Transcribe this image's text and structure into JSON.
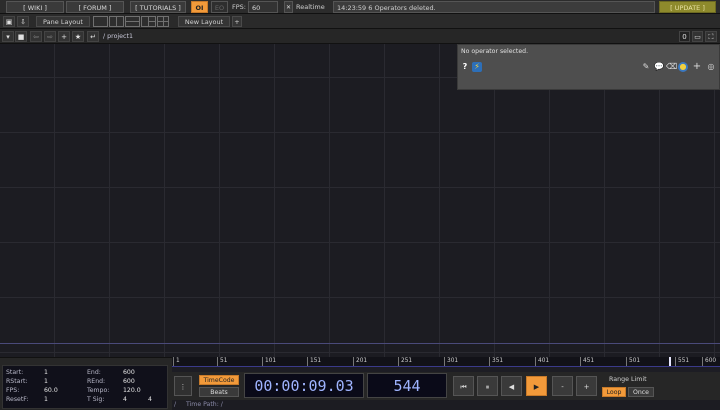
{
  "topbar": {
    "wiki": "[ WIKI ]",
    "forum": "[ FORUM ]",
    "tutorials": "[ TUTORIALS ]",
    "oi": "OI",
    "eo": "EO",
    "fps_label": "FPS:",
    "fps_value": "60",
    "realtime": "Realtime",
    "status": "14:23:59 6 Operators deleted.",
    "update": "[ UPDATE ]"
  },
  "panebar": {
    "pane_layout": "Pane Layout",
    "new_layout": "New Layout",
    "add": "+"
  },
  "pathbar": {
    "path": "/ project1",
    "right_num": "0"
  },
  "params": {
    "message": "No operator selected."
  },
  "info": {
    "start_label": "Start:",
    "start_val": "1",
    "end_label": "End:",
    "end_val": "600",
    "rstart_label": "RStart:",
    "rstart_val": "1",
    "rend_label": "REnd:",
    "rend_val": "600",
    "fps_label": "FPS:",
    "fps_val": "60.0",
    "tempo_label": "Tempo:",
    "tempo_val": "120.0",
    "resetf_label": "ResetF:",
    "resetf_val": "1",
    "tsig_label": "T Sig:",
    "tsig_a": "4",
    "tsig_b": "4"
  },
  "ruler": {
    "ticks": [
      "1",
      "51",
      "101",
      "151",
      "201",
      "251",
      "301",
      "351",
      "401",
      "451",
      "501",
      "551",
      "600"
    ]
  },
  "controls": {
    "timecode_btn": "TimeCode",
    "beats_btn": "Beats",
    "timecode": "00:00:09.03",
    "frame": "544",
    "range_limit": "Range Limit",
    "loop": "Loop",
    "once": "Once",
    "minus": "-",
    "plus": "+"
  },
  "timepath": {
    "label": "Time Path: /"
  },
  "colors": {
    "accent": "#f29a3a",
    "update": "#8e8a2c",
    "timecode_text": "#9fb4ff"
  }
}
